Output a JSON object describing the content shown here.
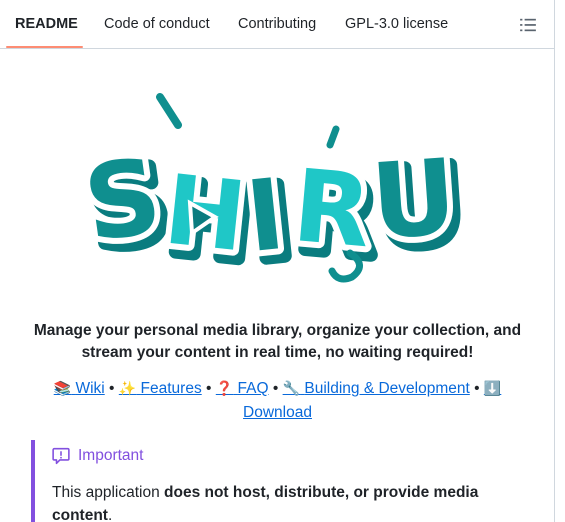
{
  "tabs": [
    {
      "label": "README",
      "active": true
    },
    {
      "label": "Code of conduct",
      "active": false
    },
    {
      "label": "Contributing",
      "active": false
    },
    {
      "label": "GPL-3.0 license",
      "active": false
    }
  ],
  "outline_icon": "list-unordered-icon",
  "logo": {
    "text": "SHIRU",
    "colors": {
      "main": "#0f8f8f",
      "light": "#1fc7c7",
      "shadow": "#0a7c7f"
    }
  },
  "tagline": "Manage your personal media library, organize your collection, and stream your content in real time, no waiting required!",
  "links": [
    {
      "emoji": "📚",
      "label": "Wiki"
    },
    {
      "emoji": "✨",
      "label": "Features"
    },
    {
      "emoji": "❓",
      "label": "FAQ"
    },
    {
      "emoji": "🔧",
      "label": "Building & Development"
    },
    {
      "emoji": "⬇️",
      "label": "Download"
    }
  ],
  "separator": "•",
  "callout": {
    "title": "Important",
    "icon": "report-icon",
    "body_prefix": "This application ",
    "body_bold": "does not host, distribute, or provide media content",
    "body_suffix": "."
  }
}
